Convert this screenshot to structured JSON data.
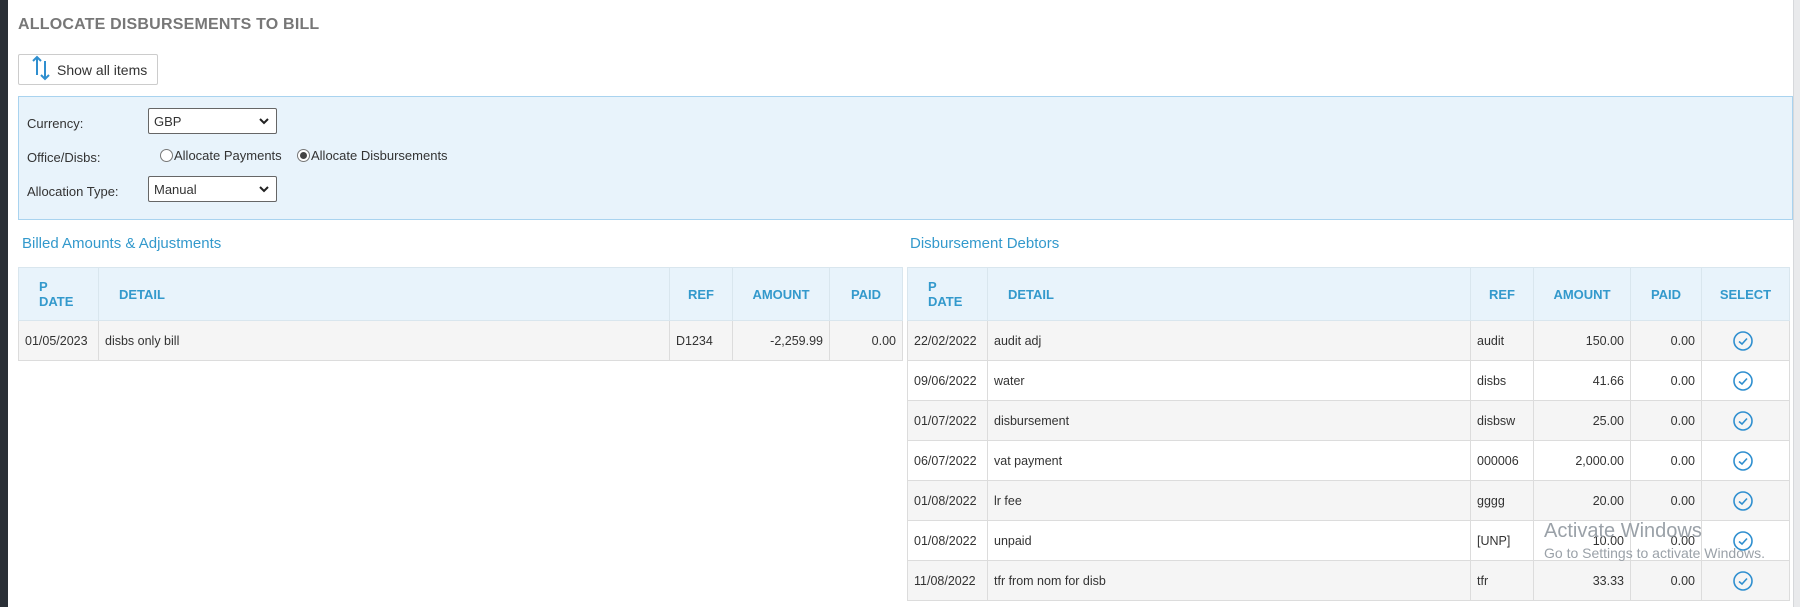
{
  "page": {
    "title": "ALLOCATE DISBURSEMENTS TO BILL",
    "show_all_label": "Show all items"
  },
  "options": {
    "currency_label": "Currency:",
    "currency_value": "GBP",
    "office_label": "Office/Disbs:",
    "radio_payments": "Allocate Payments",
    "radio_disbursements": "Allocate Disbursements",
    "selected_radio": "disbursements",
    "allocation_label": "Allocation Type:",
    "allocation_value": "Manual"
  },
  "billed": {
    "title": "Billed Amounts & Adjustments",
    "headers": {
      "date_l1": "P",
      "date_l2": "DATE",
      "detail": "DETAIL",
      "ref": "REF",
      "amount": "AMOUNT",
      "paid": "PAID"
    },
    "rows": [
      {
        "date": "01/05/2023",
        "detail": "disbs only bill",
        "ref": "D1234",
        "amount": "-2,259.99",
        "paid": "0.00"
      }
    ]
  },
  "debtors": {
    "title": "Disbursement Debtors",
    "headers": {
      "date_l1": "P",
      "date_l2": "DATE",
      "detail": "DETAIL",
      "ref": "REF",
      "amount": "AMOUNT",
      "paid": "PAID",
      "select": "SELECT"
    },
    "rows": [
      {
        "date": "22/02/2022",
        "detail": "audit adj",
        "ref": "audit",
        "amount": "150.00",
        "paid": "0.00"
      },
      {
        "date": "09/06/2022",
        "detail": "water",
        "ref": "disbs",
        "amount": "41.66",
        "paid": "0.00"
      },
      {
        "date": "01/07/2022",
        "detail": "disbursement",
        "ref": "disbsw",
        "amount": "25.00",
        "paid": "0.00"
      },
      {
        "date": "06/07/2022",
        "detail": "vat payment",
        "ref": "000006",
        "amount": "2,000.00",
        "paid": "0.00"
      },
      {
        "date": "01/08/2022",
        "detail": "lr fee",
        "ref": "gggg",
        "amount": "20.00",
        "paid": "0.00"
      },
      {
        "date": "01/08/2022",
        "detail": "unpaid",
        "ref": "[UNP]",
        "amount": "10.00",
        "paid": "0.00"
      },
      {
        "date": "11/08/2022",
        "detail": "tfr from nom for disb",
        "ref": "tfr",
        "amount": "33.33",
        "paid": "0.00"
      }
    ]
  },
  "watermark": {
    "line1": "Activate Windows",
    "line2": "Go to Settings to activate Windows."
  },
  "colors": {
    "accent": "#3399cc",
    "panel_bg": "#e8f3fb"
  },
  "icons": {
    "show_all": "sort-arrows-icon",
    "select": "check-circle-icon",
    "dropdown": "chevron-down-icon"
  }
}
